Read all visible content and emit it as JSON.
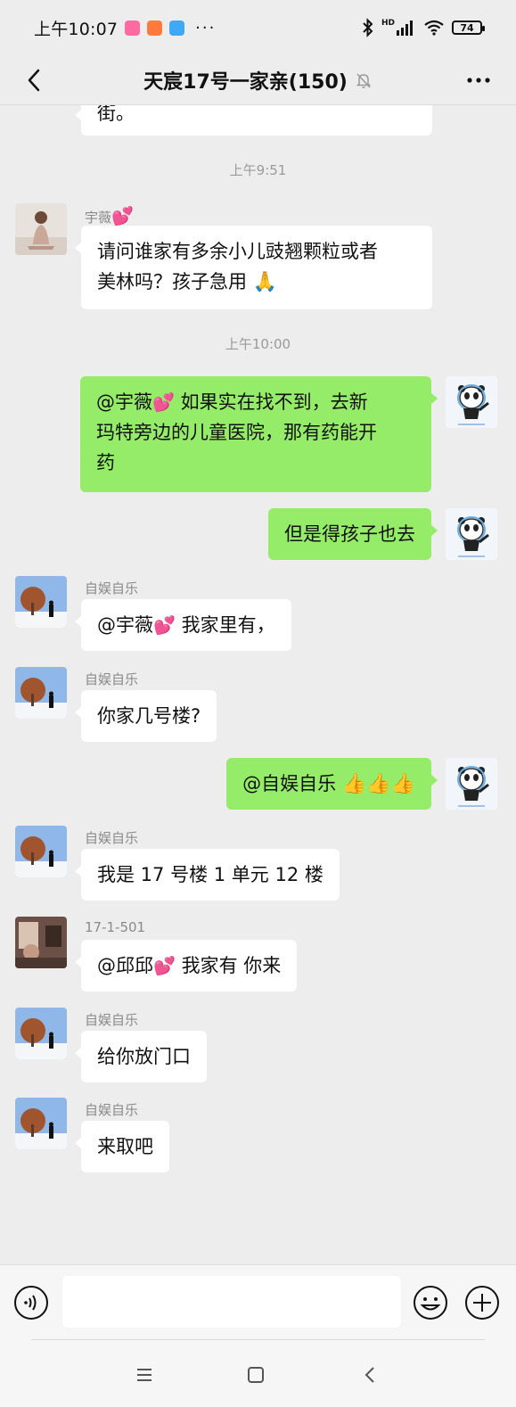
{
  "status_bar": {
    "time": "上午10:07",
    "more": "···",
    "hd": "HD",
    "battery": "74"
  },
  "header": {
    "title": "天宸17号一家亲(150)"
  },
  "messages": {
    "m0_tail": "街。",
    "ts1": "上午9:51",
    "m1_sender": "宇薇",
    "m1_line1": "请问谁家有多余小儿豉翘颗粒或者",
    "m1_line2": "美林吗？孩子急用",
    "ts2": "上午10:00",
    "m2_mention": "@宇薇",
    "m2_line1": " 如果实在找不到，去新",
    "m2_line2": "玛特旁边的儿童医院，那有药能开",
    "m2_line3": "药",
    "m3_text": "但是得孩子也去",
    "m4_sender": "自娱自乐",
    "m4_mention": "@宇薇",
    "m4_text": " 我家里有，",
    "m5_sender": "自娱自乐",
    "m5_text": "你家几号楼?",
    "m6_text": "@自娱自乐 ",
    "m7_sender": "自娱自乐",
    "m7_text": "我是 17 号楼 1 单元 12 楼",
    "m8_sender": "17-1-501",
    "m8_mention": "@邱邱",
    "m8_text": " 我家有  你来",
    "m9_sender": "自娱自乐",
    "m9_text": "给你放门口",
    "m10_sender": "自娱自乐",
    "m10_text": "来取吧"
  },
  "input": {
    "value": "",
    "placeholder": ""
  },
  "colors": {
    "self_bubble": "#95ec69",
    "other_bubble": "#ffffff",
    "background": "#ededed"
  }
}
